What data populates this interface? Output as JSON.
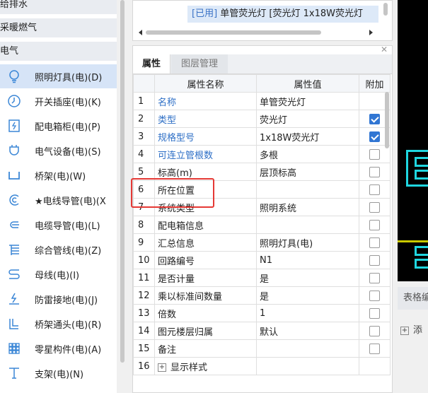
{
  "left_tree": {
    "categories": [
      "给排水",
      "采暖燃气",
      "电气"
    ],
    "items": [
      {
        "label": "照明灯具(电)(D)",
        "icon": "bulb-icon"
      },
      {
        "label": "开关插座(电)(K)",
        "icon": "switch-icon"
      },
      {
        "label": "配电箱柜(电)(P)",
        "icon": "panel-icon"
      },
      {
        "label": "电气设备(电)(S)",
        "icon": "plug-icon"
      },
      {
        "label": "桥架(电)(W)",
        "icon": "tray-icon"
      },
      {
        "label": "★电线导管(电)(X",
        "icon": "wire-conduit-icon"
      },
      {
        "label": "电缆导管(电)(L)",
        "icon": "cable-conduit-icon"
      },
      {
        "label": "综合管线(电)(Z)",
        "icon": "pipeline-icon"
      },
      {
        "label": "母线(电)(I)",
        "icon": "busbar-icon"
      },
      {
        "label": "防雷接地(电)(J)",
        "icon": "grounding-icon"
      },
      {
        "label": "桥架通头(电)(R)",
        "icon": "tray-fitting-icon"
      },
      {
        "label": "零星构件(电)(A)",
        "icon": "grid-parts-icon"
      },
      {
        "label": "支架(电)(N)",
        "icon": "bracket-icon"
      }
    ]
  },
  "top_list": {
    "tag": "[已用]",
    "entry": " 单管荧光灯 [荧光灯 1x18W荧光灯"
  },
  "tabs": [
    "属性",
    "图层管理"
  ],
  "grid": {
    "headers": [
      "",
      "属性名称",
      "属性值",
      "附加"
    ],
    "rows": [
      {
        "n": "1",
        "name": "名称",
        "value": "单管荧光灯",
        "link": true,
        "chk": null
      },
      {
        "n": "2",
        "name": "类型",
        "value": "荧光灯",
        "link": true,
        "chk": true
      },
      {
        "n": "3",
        "name": "规格型号",
        "value": "1x18W荧光灯",
        "link": true,
        "chk": true
      },
      {
        "n": "4",
        "name": "可连立管根数",
        "value": "多根",
        "link": true,
        "chk": false
      },
      {
        "n": "5",
        "name": "标高(m)",
        "value": "层顶标高",
        "link": false,
        "chk": false
      },
      {
        "n": "6",
        "name": "所在位置",
        "value": "",
        "link": false,
        "chk": false
      },
      {
        "n": "7",
        "name": "系统类型",
        "value": "照明系统",
        "link": false,
        "chk": false
      },
      {
        "n": "8",
        "name": "配电箱信息",
        "value": "",
        "link": false,
        "chk": false
      },
      {
        "n": "9",
        "name": "汇总信息",
        "value": "照明灯具(电)",
        "link": false,
        "chk": false
      },
      {
        "n": "10",
        "name": "回路编号",
        "value": "N1",
        "link": false,
        "chk": false
      },
      {
        "n": "11",
        "name": "是否计量",
        "value": "是",
        "link": false,
        "chk": false
      },
      {
        "n": "12",
        "name": "乘以标准间数量",
        "value": "是",
        "link": false,
        "chk": false
      },
      {
        "n": "13",
        "name": "倍数",
        "value": "1",
        "link": false,
        "chk": false
      },
      {
        "n": "14",
        "name": "图元楼层归属",
        "value": "默认",
        "link": false,
        "chk": false
      },
      {
        "n": "15",
        "name": "备注",
        "value": "",
        "link": false,
        "chk": false
      },
      {
        "n": "16",
        "name": "显示样式",
        "value": "",
        "link": false,
        "chk": null,
        "expand": "+"
      }
    ]
  },
  "right_panel": {
    "header": "表格编",
    "add_label": "添"
  },
  "colors": {
    "link_blue": "#2e6fc6",
    "checkbox_blue": "#3176d3",
    "highlight_red": "#e53935",
    "cad_cyan": "#1fd6e0"
  }
}
